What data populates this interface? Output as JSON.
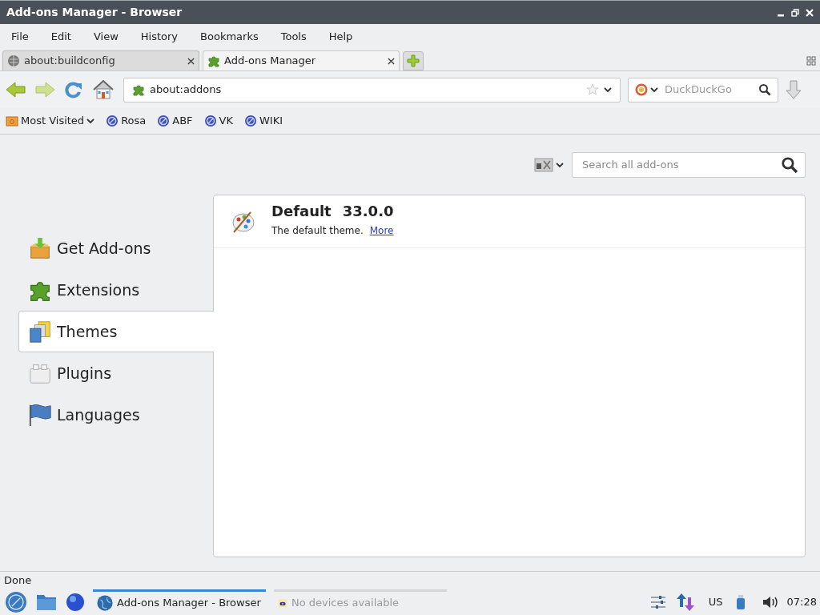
{
  "window": {
    "title": "Add-ons Manager - Browser"
  },
  "menu": [
    "File",
    "Edit",
    "View",
    "History",
    "Bookmarks",
    "Tools",
    "Help"
  ],
  "tabs": [
    {
      "label": "about:buildconfig",
      "selected": false,
      "kind": "globe"
    },
    {
      "label": "Add-ons Manager",
      "selected": true,
      "kind": "puzzle"
    }
  ],
  "address": {
    "value": "about:addons"
  },
  "search": {
    "placeholder": "DuckDuckGo"
  },
  "bookmarks": [
    {
      "label": "Most Visited",
      "kind": "folder"
    },
    {
      "label": "Rosa",
      "kind": "site"
    },
    {
      "label": "ABF",
      "kind": "site"
    },
    {
      "label": "VK",
      "kind": "site"
    },
    {
      "label": "WIKI",
      "kind": "site"
    }
  ],
  "addon_search": {
    "placeholder": "Search all add-ons"
  },
  "categories": [
    {
      "label": "Get Add-ons",
      "selected": false,
      "kind": "box"
    },
    {
      "label": "Extensions",
      "selected": false,
      "kind": "puzzle"
    },
    {
      "label": "Themes",
      "selected": true,
      "kind": "themes"
    },
    {
      "label": "Plugins",
      "selected": false,
      "kind": "plugin"
    },
    {
      "label": "Languages",
      "selected": false,
      "kind": "flag"
    }
  ],
  "addons": [
    {
      "name": "Default",
      "version": "33.0.0",
      "description": "The default theme.",
      "link": "More"
    }
  ],
  "status_bar": "Done",
  "taskbar": {
    "tasks": [
      {
        "label": "Add-ons Manager - Browser",
        "selected": true,
        "kind": "browser"
      },
      {
        "label": "No devices available",
        "selected": false,
        "kind": "device"
      }
    ],
    "layout": "US",
    "clock": "07:28"
  }
}
